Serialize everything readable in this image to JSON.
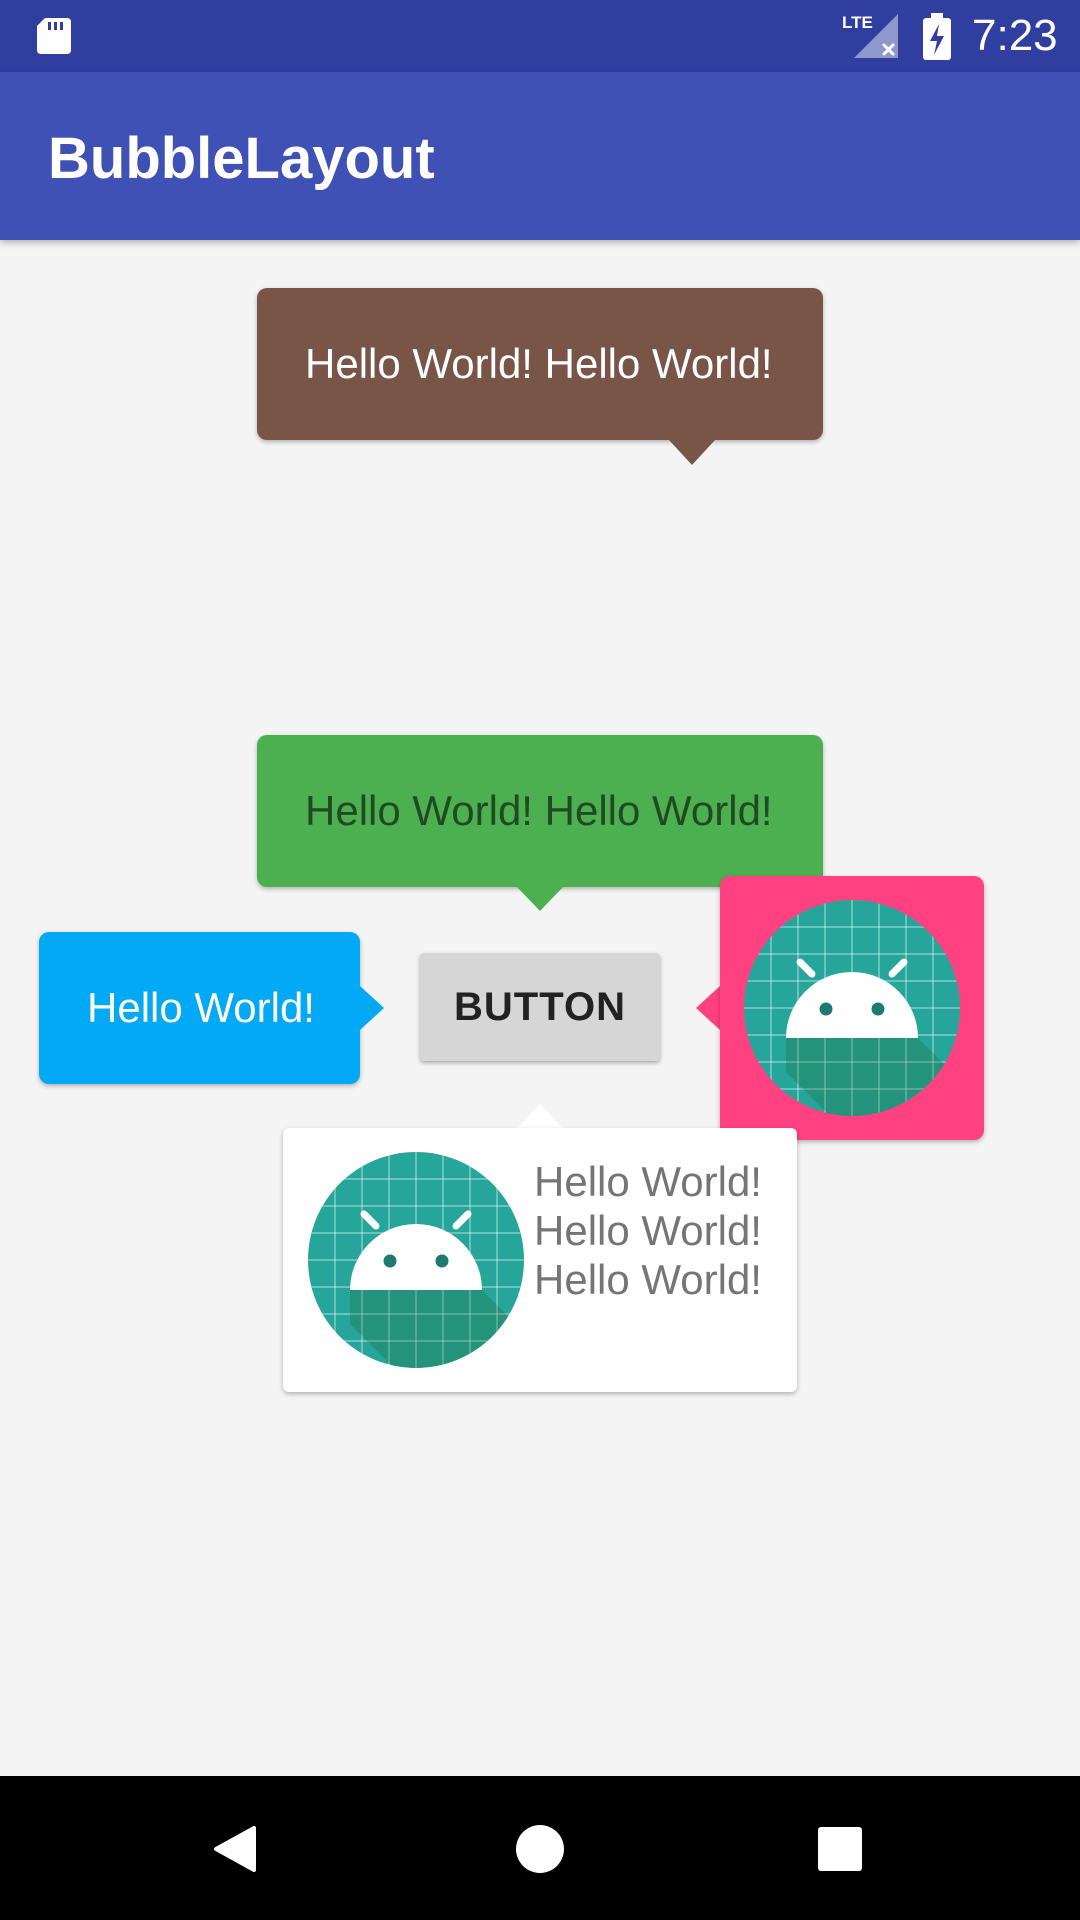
{
  "status_bar": {
    "time": "7:23",
    "network_label": "LTE",
    "icons": [
      "sd-card-icon",
      "signal-icon",
      "battery-charging-icon"
    ],
    "background": "#303f9f"
  },
  "app_bar": {
    "title": "BubbleLayout",
    "background": "#3f51b5"
  },
  "bubbles": {
    "brown": {
      "text": "Hello World!  Hello World!",
      "color": "#795548"
    },
    "green": {
      "text": "Hello World!  Hello World!",
      "color": "#4caf50"
    },
    "blue": {
      "text": "Hello World!",
      "color": "#03a9f4"
    },
    "pink": {
      "icon": "android-logo-icon",
      "color": "#ff4081"
    },
    "white": {
      "icon": "android-logo-icon",
      "lines": [
        "Hello World!",
        "Hello World!",
        "Hello World!"
      ],
      "color": "#ffffff"
    }
  },
  "button": {
    "label": "BUTTON"
  },
  "nav_bar": {
    "icons": [
      "back-icon",
      "home-icon",
      "recents-icon"
    ]
  }
}
